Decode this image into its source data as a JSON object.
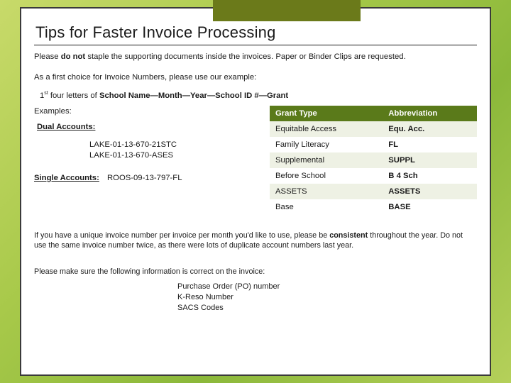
{
  "title": "Tips for Faster Invoice Processing",
  "p1_pre": "Please ",
  "p1_bold": "do not",
  "p1_post": " staple the supporting documents inside the invoices. Paper or Binder Clips are requested.",
  "p2": "As a first choice for Invoice Numbers, please use our example:",
  "fmt_prefix": "1",
  "fmt_sup": "st",
  "fmt_mid": " four letters of ",
  "fmt_bold": "School Name—Month—Year—School ID #—Grant",
  "examples_label": "Examples:",
  "dual_label": "Dual Accounts:",
  "dual_items": [
    "LAKE-01-13-670-21STC",
    "LAKE-01-13-670-ASES"
  ],
  "single_label": "Single Accounts:",
  "single_value": "ROOS-09-13-797-FL",
  "table": {
    "h1": "Grant Type",
    "h2": "Abbreviation",
    "rows": [
      {
        "c1": "Equitable Access",
        "c2": "Equ. Acc."
      },
      {
        "c1": "Family Literacy",
        "c2": " FL"
      },
      {
        "c1": "Supplemental",
        "c2": "SUPPL"
      },
      {
        "c1": "Before School",
        "c2": "B 4 Sch"
      },
      {
        "c1": "ASSETS",
        "c2": "ASSETS"
      },
      {
        "c1": "Base",
        "c2": "BASE"
      }
    ]
  },
  "note1_pre": "If you have a unique invoice number per invoice per month you'd like to use, please be ",
  "note1_bold": "consistent",
  "note1_post": " throughout the year.  Do not use the same invoice number twice, as there were lots of duplicate account numbers last year.",
  "note2": "Please  make sure the following information is correct on the invoice:",
  "info_items": [
    "Purchase Order (PO) number",
    "K-Reso Number",
    "SACS Codes"
  ]
}
